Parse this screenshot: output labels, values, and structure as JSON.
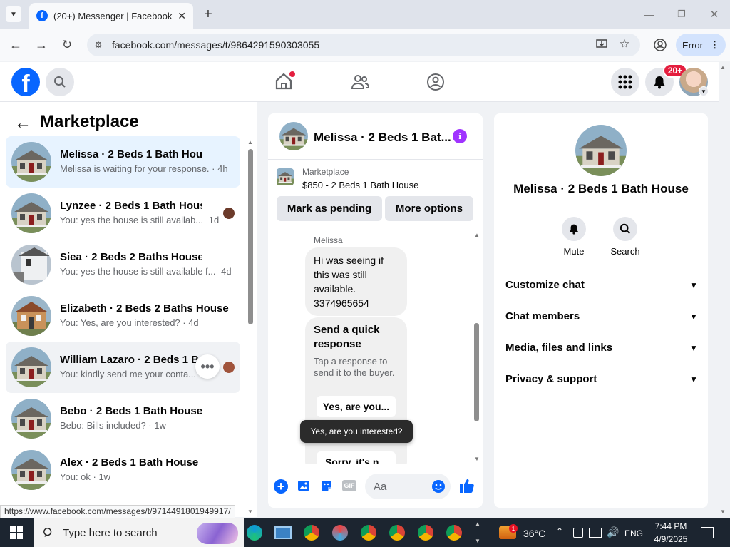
{
  "browser": {
    "tab_title": "(20+) Messenger | Facebook",
    "url": "facebook.com/messages/t/9864291590303055",
    "profile_status": "Error",
    "status_url": "https://www.facebook.com/messages/t/9714491801949917/"
  },
  "fb_nav": {
    "notification_badge": "20+"
  },
  "left": {
    "title": "Marketplace",
    "conversations": [
      {
        "name": "Melissa · 2 Beds 1 Bath House",
        "preview": "Melissa is waiting for your response. · 4h"
      },
      {
        "name": "Lynzee · 2 Beds 1 Bath House",
        "preview": "You: yes the house is still availab...",
        "time": "1d"
      },
      {
        "name": "Siea · 2 Beds 2 Baths House",
        "preview": "You: yes the house is still available f...",
        "time": "4d"
      },
      {
        "name": "Elizabeth · 2 Beds 2 Baths House",
        "preview": "You: Yes, are you interested? · 4d"
      },
      {
        "name": "William Lazaro · 2 Beds 1 Bath",
        "preview": "You: kindly send me your conta..."
      },
      {
        "name": "Bebo · 2 Beds 1 Bath House",
        "preview": "Bebo: Bills included? · 1w"
      },
      {
        "name": "Alex · 2 Beds 1 Bath House",
        "preview": "You: ok · 1w"
      }
    ]
  },
  "chat": {
    "header_title": "Melissa · 2 Beds 1 Bat...",
    "listing_source": "Marketplace",
    "listing_title": "$850 - 2 Beds 1 Bath House",
    "mark_pending_label": "Mark as pending",
    "more_options_label": "More options",
    "sender": "Melissa",
    "message": "Hi was seeing if this was still available. 3374965654",
    "quick_title": "Send a quick response",
    "quick_sub": "Tap a response to send it to the buyer.",
    "quick_reply_1": "Yes, are you...",
    "quick_reply_2": "Sorry, it's n...",
    "tooltip": "Yes, are you interested?",
    "composer_placeholder": "Aa"
  },
  "right": {
    "name": "Melissa · 2 Beds 1 Bath House",
    "mute_label": "Mute",
    "search_label": "Search",
    "sections": [
      "Customize chat",
      "Chat members",
      "Media, files and links",
      "Privacy & support"
    ]
  },
  "taskbar": {
    "search_placeholder": "Type here to search",
    "weather": "36°C",
    "language": "ENG",
    "time": "7:44 PM",
    "date": "4/9/2025",
    "weather_badge": "1"
  },
  "colors": {
    "fb_blue": "#0866ff",
    "messenger_purple": "#a033ff",
    "notif_red": "#e41e3f"
  }
}
